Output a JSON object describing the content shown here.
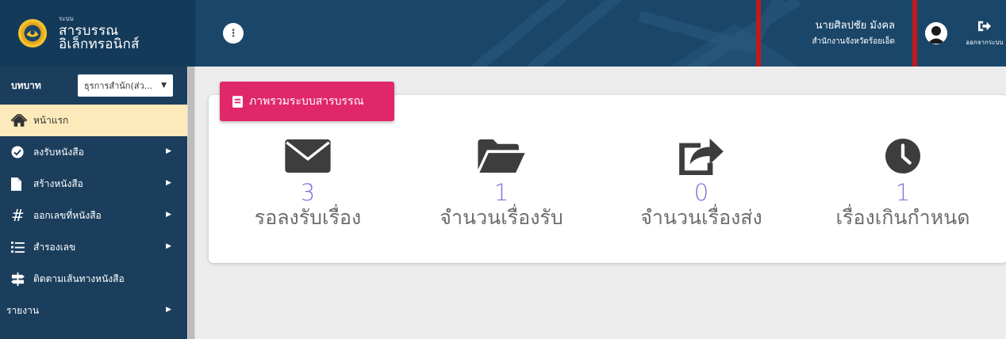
{
  "header": {
    "system_sub": "ระบบ",
    "system_title": "สารบรรณอิเล็กทรอนิกส์",
    "user_name": "นายศิลปชัย มังคล",
    "user_office": "สำนักงานจังหวัดร้อยเอ็ด",
    "logout_label": "ออกจากระบบ",
    "kebab_icon": "vertical-dots-icon",
    "highlight_color": "#c21a1a"
  },
  "sidebar": {
    "role_label": "บทบาท",
    "role_value": "ธุรการสำนัก(ส่ว...",
    "items": [
      {
        "label": "หน้าแรก",
        "icon": "home-icon",
        "active": true,
        "arrow": false
      },
      {
        "label": "ลงรับหนังสือ",
        "icon": "check-circle-icon",
        "active": false,
        "arrow": true
      },
      {
        "label": "สร้างหนังสือ",
        "icon": "file-icon",
        "active": false,
        "arrow": true
      },
      {
        "label": "ออกเลขที่หนังสือ",
        "icon": "hash-icon",
        "active": false,
        "arrow": true
      },
      {
        "label": "สำรองเลข",
        "icon": "numbered-list-icon",
        "active": false,
        "arrow": true
      },
      {
        "label": "ติดตามเส้นทางหนังสือ",
        "icon": "signpost-icon",
        "active": false,
        "arrow": false
      },
      {
        "label": "รายงาน",
        "icon": "",
        "active": false,
        "arrow": true
      }
    ]
  },
  "main": {
    "panel_title": "ภาพรวมระบบสารบรรณ",
    "accent_color": "#e0276a",
    "count_color": "#7d72d6",
    "stats": [
      {
        "count": "3",
        "label": "รอลงรับเรื่อง",
        "icon": "envelope-icon"
      },
      {
        "count": "1",
        "label": "จำนวนเรื่องรับ",
        "icon": "folder-open-icon"
      },
      {
        "count": "0",
        "label": "จำนวนเรื่องส่ง",
        "icon": "share-icon"
      },
      {
        "count": "1",
        "label": "เรื่องเกินกำหนด",
        "icon": "clock-icon"
      }
    ]
  }
}
